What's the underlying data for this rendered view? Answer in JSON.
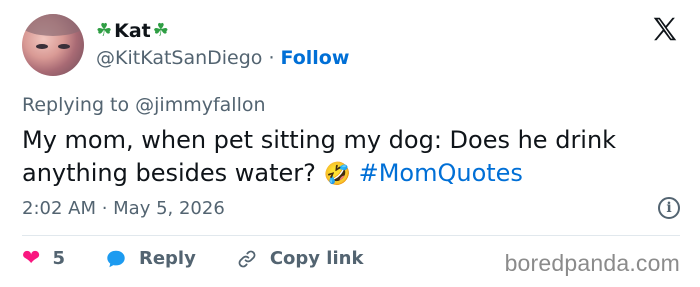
{
  "user": {
    "display_name": "Kat",
    "handle": "@KitKatSanDiego",
    "separator": "·",
    "follow_label": "Follow"
  },
  "replying_to": "Replying to @jimmyfallon",
  "tweet": {
    "text": "My mom, when pet sitting my dog: Does he drink anything besides water?",
    "emoji": "🤣",
    "hashtag": "#MomQuotes"
  },
  "timestamp": "2:02 AM · May 5, 2026",
  "actions": {
    "likes_count": "5",
    "reply_label": "Reply",
    "copy_link_label": "Copy link"
  },
  "watermark": "boredpanda.com",
  "colors": {
    "link": "#006fd6",
    "heart": "#f91880",
    "muted": "#536471",
    "clover": "#2f9e44"
  }
}
